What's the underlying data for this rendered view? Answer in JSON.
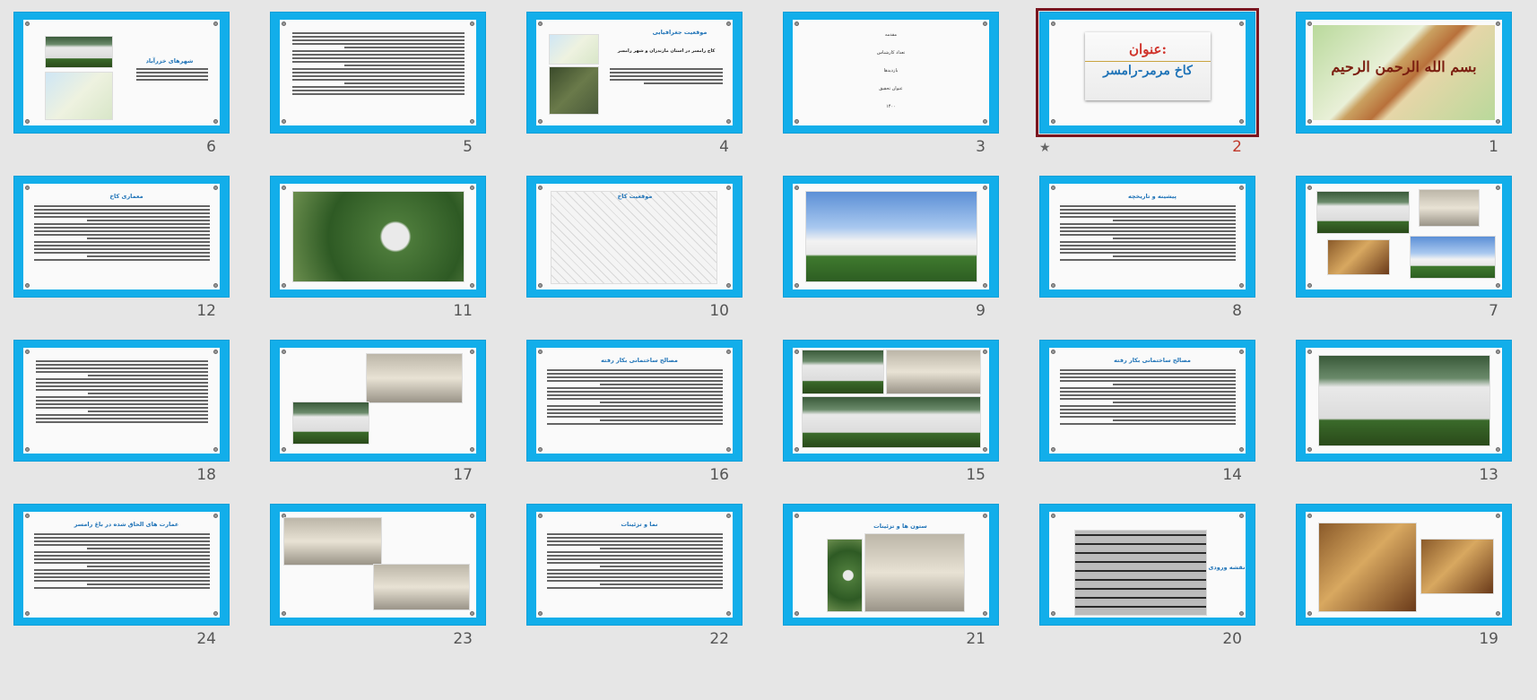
{
  "colors": {
    "slide_frame": "#12aeea",
    "selected_outline": "#7a1620",
    "selected_number": "#c0392b",
    "title_blue": "#1f73b7",
    "title_red": "#d0342c"
  },
  "slides": [
    {
      "number": "1",
      "kind": "cover",
      "cover_text": "بسم الله الرحمن الرحیم"
    },
    {
      "number": "2",
      "kind": "title",
      "selected": true,
      "star": "★",
      "title": "عنوان:",
      "subtitle": "کاخ مرمر-رامسر"
    },
    {
      "number": "3",
      "kind": "menu",
      "items": [
        "مقدمه",
        "تعداد کارشناس",
        "بازدیدها",
        "عنوان تحقیق",
        "۱۴۰۰"
      ]
    },
    {
      "number": "4",
      "kind": "map-text",
      "title": "موقعیت جغرافیایی",
      "lead": "کاخ رامسر در استان مازندران و شهر رامسر"
    },
    {
      "number": "5",
      "kind": "text"
    },
    {
      "number": "6",
      "kind": "photo-map",
      "title": "شهرهای خزرآباد"
    },
    {
      "number": "7",
      "kind": "collage4"
    },
    {
      "number": "8",
      "kind": "text-title",
      "title": "پیشینه و تاریخچه"
    },
    {
      "number": "9",
      "kind": "photo",
      "photo": "palace-sky"
    },
    {
      "number": "10",
      "kind": "plan",
      "title": "موقعیت کاخ"
    },
    {
      "number": "11",
      "kind": "photo",
      "photo": "aerial-garden"
    },
    {
      "number": "12",
      "kind": "text-title",
      "title": "معماری کاخ"
    },
    {
      "number": "13",
      "kind": "photo",
      "photo": "palace-front"
    },
    {
      "number": "14",
      "kind": "text-title",
      "title": "مصالح ساختمانی بکار رفته"
    },
    {
      "number": "15",
      "kind": "collage3"
    },
    {
      "number": "16",
      "kind": "text-title",
      "title": "مصالح ساختمانی بکار رفته"
    },
    {
      "number": "17",
      "kind": "photos2"
    },
    {
      "number": "18",
      "kind": "text"
    },
    {
      "number": "19",
      "kind": "interior2"
    },
    {
      "number": "20",
      "kind": "floorplan",
      "title": "نقشه ورودی"
    },
    {
      "number": "21",
      "kind": "photos-title",
      "title": "ستون ها و تزئینات"
    },
    {
      "number": "22",
      "kind": "text-title",
      "title": "نما و تزئینات"
    },
    {
      "number": "23",
      "kind": "stairs2"
    },
    {
      "number": "24",
      "kind": "text-title",
      "title": "عمارت های الحاق شده در باغ رامسر"
    }
  ]
}
